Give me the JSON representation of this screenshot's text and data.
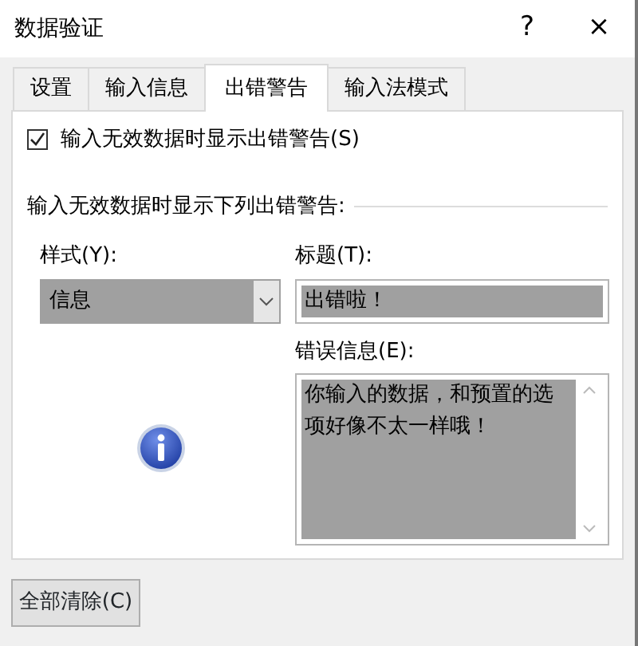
{
  "window": {
    "title": "数据验证",
    "help": "?",
    "close": "×"
  },
  "tabs": [
    {
      "label": "设置",
      "selected": false
    },
    {
      "label": "输入信息",
      "selected": false
    },
    {
      "label": "出错警告",
      "selected": true
    },
    {
      "label": "输入法模式",
      "selected": false
    }
  ],
  "show_alert": {
    "label": "输入无效数据时显示出错警告(S)",
    "checked": true
  },
  "group_label": "输入无效数据时显示下列出错警告:",
  "style": {
    "label": "样式(Y):",
    "value": "信息"
  },
  "title_field": {
    "label": "标题(T):",
    "value": "出错啦！"
  },
  "message_field": {
    "label": "错误信息(E):",
    "value": "你输入的数据，和预置的选项好像不太一样哦！"
  },
  "buttons": [
    {
      "label": "全部清除(C)"
    }
  ]
}
